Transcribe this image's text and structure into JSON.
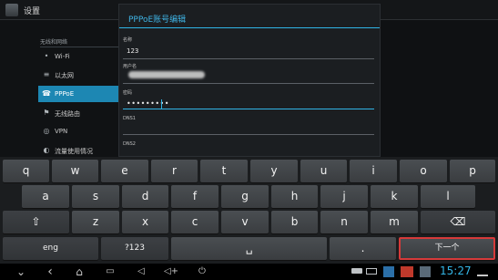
{
  "settings": {
    "title": "设置",
    "section_header": "无线和网络",
    "items": [
      {
        "label": "Wi-Fi",
        "icon": "wifi-icon",
        "glyph": "•"
      },
      {
        "label": "以太网",
        "icon": "ethernet-icon",
        "glyph": "≡"
      },
      {
        "label": "PPPoE",
        "icon": "phone-icon",
        "glyph": "☎",
        "selected": true
      },
      {
        "label": "无线路由",
        "icon": "hotspot-icon",
        "glyph": "⚑"
      },
      {
        "label": "VPN",
        "icon": "vpn-icon",
        "glyph": "◎"
      },
      {
        "label": "流量使用情况",
        "icon": "data-usage-icon",
        "glyph": "◐"
      }
    ]
  },
  "dialog": {
    "title": "PPPoE账号编辑",
    "fields": {
      "name_label": "名称",
      "name_value": "123",
      "user_label": "用户名",
      "password_label": "密码",
      "password_value": "•••••••••",
      "dns1_label": "DNS1",
      "dns2_label": "DNS2"
    }
  },
  "keyboard": {
    "row1": [
      "q",
      "w",
      "e",
      "r",
      "t",
      "y",
      "u",
      "i",
      "o",
      "p"
    ],
    "row2": [
      "a",
      "s",
      "d",
      "f",
      "g",
      "h",
      "j",
      "k",
      "l"
    ],
    "row3": [
      "z",
      "x",
      "c",
      "v",
      "b",
      "n",
      "m"
    ],
    "shift_glyph": "⇧",
    "delete_glyph": "⌫",
    "lang_label": "eng",
    "symbols_label": "?123",
    "space_glyph": "␣",
    "period_label": ".",
    "next_label": "下一个"
  },
  "navbar": {
    "clock": "15:27",
    "back_glyph": "‹",
    "home_glyph": "⌂",
    "recent_glyph": "▭",
    "vol_down_glyph": "◁",
    "vol_up_glyph": "◁+",
    "screenshot_glyph": "✲",
    "power_glyph": "⏻",
    "colors": {
      "accent": "#33b5e5",
      "next_border": "#d63a3a",
      "selected": "#1d87b3"
    }
  }
}
